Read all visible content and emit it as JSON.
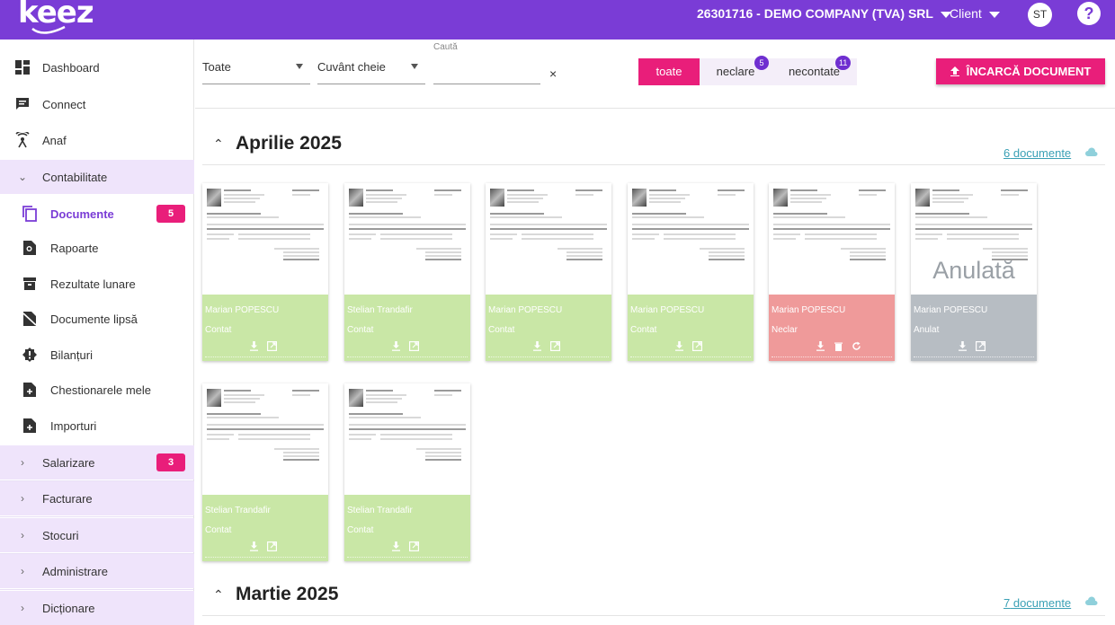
{
  "topbar": {
    "logo": "keez",
    "company": "26301716 -  DEMO COMPANY (TVA) SRL",
    "client": "Client",
    "avatar": "ST",
    "help": "?"
  },
  "sidebar": {
    "items": [
      {
        "label": "Dashboard",
        "icon": "dashboard-icon"
      },
      {
        "label": "Connect",
        "icon": "chat-icon"
      },
      {
        "label": "Anaf",
        "icon": "antenna-icon"
      },
      {
        "label": "Contabilitate",
        "icon": "chevron-down-icon"
      },
      {
        "label": "Documente",
        "icon": "copy-icon",
        "badge": "5"
      },
      {
        "label": "Rapoarte",
        "icon": "report-search-icon"
      },
      {
        "label": "Rezultate lunare",
        "icon": "archive-icon"
      },
      {
        "label": "Documente lipsă",
        "icon": "document-off-icon"
      },
      {
        "label": "Bilanțuri",
        "icon": "alert-badge-icon"
      },
      {
        "label": "Chestionarele mele",
        "icon": "document-add-icon"
      },
      {
        "label": "Importuri",
        "icon": "document-add-icon"
      },
      {
        "label": "Salarizare",
        "icon": "chevron-right-icon",
        "badge": "3"
      },
      {
        "label": "Facturare",
        "icon": "chevron-right-icon"
      },
      {
        "label": "Stocuri",
        "icon": "chevron-right-icon"
      },
      {
        "label": "Administrare",
        "icon": "chevron-right-icon"
      },
      {
        "label": "Dicționare",
        "icon": "chevron-right-icon"
      }
    ]
  },
  "filters": {
    "type": "Toate",
    "field": "Cuvânt cheie",
    "search_label": "Caută",
    "search_value": "",
    "clear": "×"
  },
  "segments": {
    "all": "toate",
    "unclear": "neclare",
    "unclear_count": "5",
    "unaccounted": "necontate",
    "unaccounted_count": "11"
  },
  "upload_button": "ÎNCARCĂ DOCUMENT",
  "groups": [
    {
      "title": "Aprilie 2025",
      "count_link_num": "6",
      "count_link_text": " documente",
      "cards": [
        {
          "name": "Marian POPESCU",
          "status": "Contat",
          "color": "green"
        },
        {
          "name": "Stelian Trandafir",
          "status": "Contat",
          "color": "green"
        },
        {
          "name": "Marian POPESCU",
          "status": "Contat",
          "color": "green"
        },
        {
          "name": "Marian POPESCU",
          "status": "Contat",
          "color": "green"
        },
        {
          "name": "Marian POPESCU",
          "status": "Neclar",
          "color": "red"
        },
        {
          "name": "Marian POPESCU",
          "status": "Anulat",
          "color": "grey",
          "overlay": "Anulată"
        },
        {
          "name": "Stelian Trandafir",
          "status": "Contat",
          "color": "green"
        },
        {
          "name": "Stelian Trandafir",
          "status": "Contat",
          "color": "green"
        }
      ]
    },
    {
      "title": "Martie 2025",
      "count_link_num": "7",
      "count_link_text": " documente"
    }
  ],
  "colors": {
    "brand": "#7a3cd6",
    "accent": "#e91e7a",
    "contat": "#c9e7a6",
    "neclar": "#ef9a9a",
    "anulat": "#b7bdc3"
  }
}
